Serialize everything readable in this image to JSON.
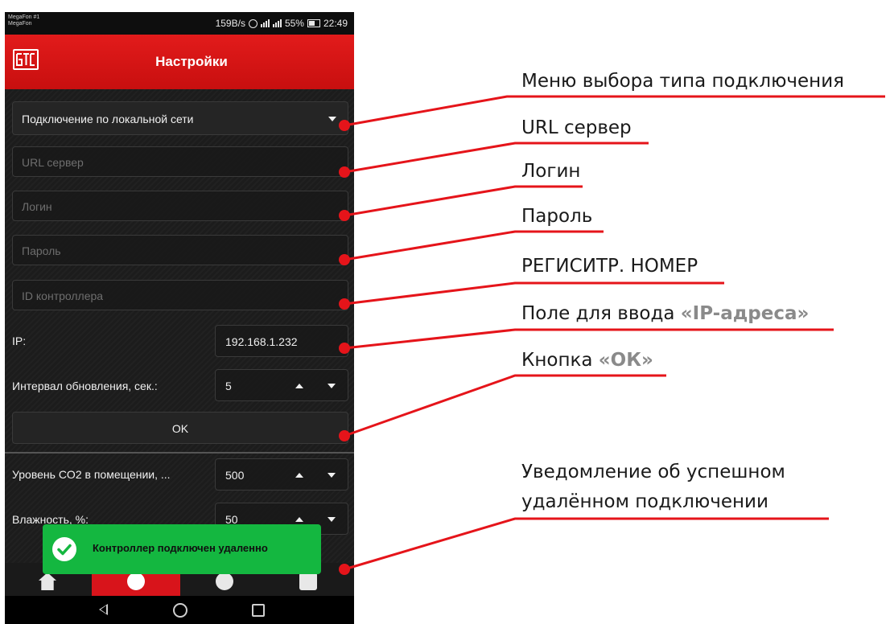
{
  "status_bar": {
    "carrier_line1": "MegaFon #1",
    "carrier_line2": "MegaFon",
    "net_speed": "159B/s",
    "battery": "55%",
    "time": "22:49",
    "icons": [
      "alarm-icon",
      "signal-icon",
      "signal-icon",
      "battery-icon"
    ]
  },
  "app_bar": {
    "title": "Настройки",
    "logo_icon": "btc-logo-icon",
    "color": "#d8141b"
  },
  "form": {
    "connection_type": "Подключение по локальной сети",
    "url_placeholder": "URL сервер",
    "login_placeholder": "Логин",
    "password_placeholder": "Пароль",
    "controller_id_placeholder": "ID контроллера",
    "ip_label": "IP:",
    "ip_value": "192.168.1.232",
    "interval_label": "Интервал обновления, сек.:",
    "interval_value": "5",
    "ok_label": "OK",
    "co2_label": "Уровень CO2 в помещении, ...",
    "co2_value": "500",
    "humidity_label": "Влажность, %:",
    "humidity_value": "50"
  },
  "toast": {
    "text": "Контроллер подключен удаленно",
    "color": "#14b740",
    "icon": "check-circle-icon"
  },
  "bottom_nav": {
    "icons": [
      "home-icon",
      "gear-icon",
      "info-icon",
      "battery-icon"
    ]
  },
  "android_nav": {
    "icons": [
      "back-icon",
      "home-circle-icon",
      "recent-apps-icon"
    ]
  },
  "annotations": {
    "menu_select": "Меню выбора типа подключения",
    "url_server": "URL сервер",
    "login": "Логин",
    "password": "Пароль",
    "reg_number": "РЕГИСИТР. НОМЕР",
    "ip_field_prefix": "Поле для ввода ",
    "ip_field_highlight": "«IP-адреса»",
    "ok_prefix": "Кнопка ",
    "ok_highlight": "«ОК»",
    "notify_line1": "Уведомление об успешном",
    "notify_line2": "удалённом подключении",
    "marker_color": "#e5141a"
  }
}
